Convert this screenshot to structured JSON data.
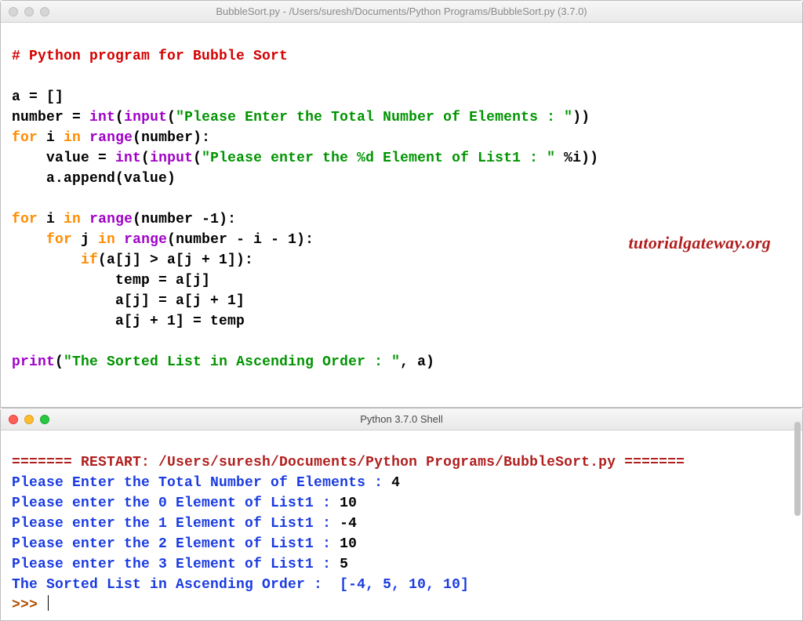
{
  "editor_window": {
    "title": "BubbleSort.py - /Users/suresh/Documents/Python Programs/BubbleSort.py (3.7.0)",
    "traffic_active": false
  },
  "shell_window": {
    "title": "Python 3.7.0 Shell",
    "traffic_active": true
  },
  "watermark": "tutorialgateway.org",
  "code": {
    "l01_comment": "# Python program for Bubble Sort",
    "l03_a": "a = []",
    "l04_number_lhs": "number = ",
    "l04_int": "int",
    "l04_input": "input",
    "l04_str": "\"Please Enter the Total Number of Elements : \"",
    "l05_for": "for",
    "l05_i": " i ",
    "l05_in": "in",
    "l05_sp": " ",
    "l05_range": "range",
    "l05_rest": "(number):",
    "l06_indent": "    value = ",
    "l06_int": "int",
    "l06_input": "input",
    "l06_str": "\"Please enter the %d Element of List1 : \"",
    "l06_tail": " %i))",
    "l07": "    a.append(value)",
    "l09_for": "for",
    "l09_mid": " i ",
    "l09_in": "in",
    "l09_sp": " ",
    "l09_range": "range",
    "l09_rest": "(number -1):",
    "l10_indent": "    ",
    "l10_for": "for",
    "l10_mid": " j ",
    "l10_in": "in",
    "l10_sp": " ",
    "l10_range": "range",
    "l10_rest": "(number - i - 1):",
    "l11_indent": "        ",
    "l11_if": "if",
    "l11_rest": "(a[j] > a[j + 1]):",
    "l12": "            temp = a[j]",
    "l13": "            a[j] = a[j + 1]",
    "l14": "            a[j + 1] = temp",
    "l16_print": "print",
    "l16_open": "(",
    "l16_str": "\"The Sorted List in Ascending Order : \"",
    "l16_tail": ", a)"
  },
  "shell": {
    "restart_eq_left": "======= ",
    "restart_label": "RESTART: /Users/suresh/Documents/Python Programs/BubbleSort.py",
    "restart_eq_right": " =======",
    "line1_prompt": "Please Enter the Total Number of Elements : ",
    "line1_val": "4",
    "line2_prompt": "Please enter the 0 Element of List1 : ",
    "line2_val": "10",
    "line3_prompt": "Please enter the 1 Element of List1 : ",
    "line3_val": "-4",
    "line4_prompt": "Please enter the 2 Element of List1 : ",
    "line4_val": "10",
    "line5_prompt": "Please enter the 3 Element of List1 : ",
    "line5_val": "5",
    "result": "The Sorted List in Ascending Order :  [-4, 5, 10, 10]",
    "prompt": ">>> "
  }
}
